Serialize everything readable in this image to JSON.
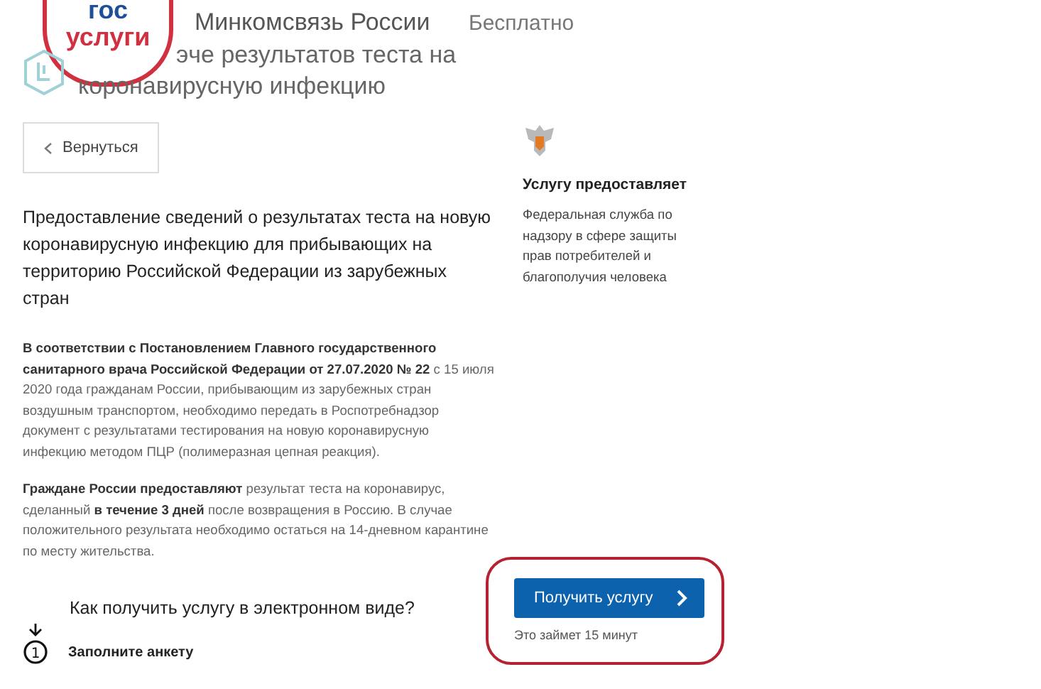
{
  "header": {
    "logo_lines": [
      "гос",
      "услуги"
    ],
    "ministry": "Минкомсвязь России",
    "price": "Бесплатно",
    "title_lines": [
      "эче результатов теста на",
      "коронавирусную инфекцию"
    ]
  },
  "back_button": {
    "label": "Вернуться"
  },
  "service_title": "Предоставление сведений о результатах теста на новую коронавирусную инфекцию для прибывающих на территорию Российской Федерации из зарубежных стран",
  "paragraphs": [
    "**В соответствии с Постановлением Главного государственного санитарного врача Российской Федерации от 27.07.2020 № 22** с 15 июля 2020 года гражданам России, прибывающим из зарубежных стран воздушным транспортом, необходимо передать в Роспотребнадзор документ с результатами тестирования на новую коронавирусную инфекцию методом ПЦР (полимеразная цепная реакция).",
    "**Граждане России предоставляют** результат теста на коронавирус, сделанный **в течение 3 дней** после возвращения в Россию. В случае положительного результата необходимо остаться на 14-дневном карантине по месту жительства."
  ],
  "how_to": {
    "title": "Как получить услугу в электронном виде?",
    "steps": [
      {
        "number": "1",
        "label": "Заполните анкету"
      }
    ]
  },
  "provider": {
    "heading": "Услугу предоставляет",
    "name": "Федеральная служба по надзору в сфере защиты прав потребителей и благополучия человека"
  },
  "action": {
    "button": "Получить услугу",
    "duration": "Это займет 15 минут",
    "highlighted": true
  }
}
